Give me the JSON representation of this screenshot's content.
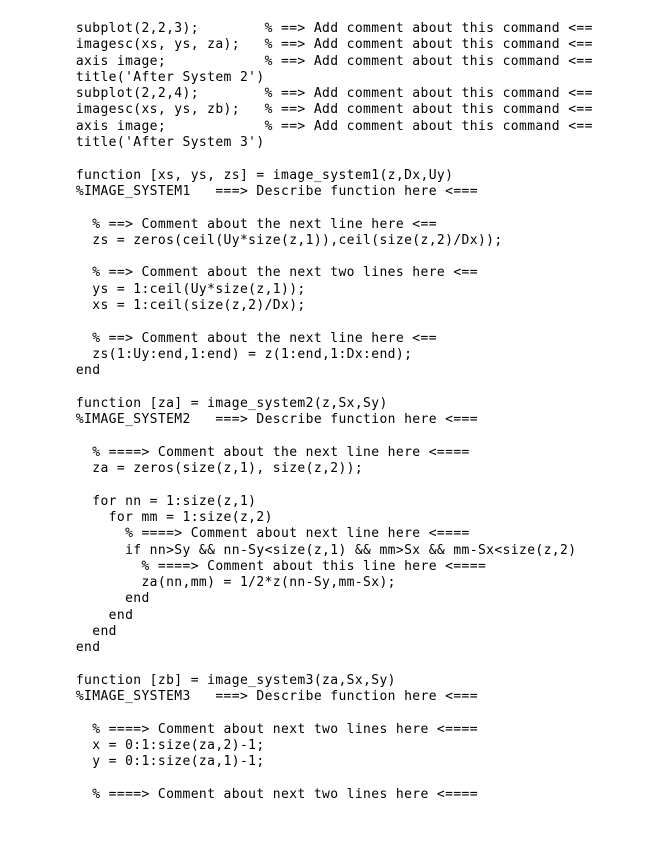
{
  "document": {
    "kind": "matlab-code-listing",
    "language": "MATLAB",
    "background_color": "#ffffff",
    "text_color": "#000000"
  },
  "code": {
    "lines": [
      "    subplot(2,2,3);        % ==> Add comment about this command <==",
      "    imagesc(xs, ys, za);   % ==> Add comment about this command <==",
      "    axis image;            % ==> Add comment about this command <==",
      "    title('After System 2')",
      "    subplot(2,2,4);        % ==> Add comment about this command <==",
      "    imagesc(xs, ys, zb);   % ==> Add comment about this command <==",
      "    axis image;            % ==> Add comment about this command <==",
      "    title('After System 3')",
      "",
      "    function [xs, ys, zs] = image_system1(z,Dx,Uy)",
      "    %IMAGE_SYSTEM1   ===> Describe function here <===",
      "",
      "      % ==> Comment about the next line here <==",
      "      zs = zeros(ceil(Uy*size(z,1)),ceil(size(z,2)/Dx));",
      "",
      "      % ==> Comment about the next two lines here <==",
      "      ys = 1:ceil(Uy*size(z,1));",
      "      xs = 1:ceil(size(z,2)/Dx);",
      "",
      "      % ==> Comment about the next line here <==",
      "      zs(1:Uy:end,1:end) = z(1:end,1:Dx:end);",
      "    end",
      "",
      "    function [za] = image_system2(z,Sx,Sy)",
      "    %IMAGE_SYSTEM2   ===> Describe function here <===",
      "",
      "      % ====> Comment about the next line here <====",
      "      za = zeros(size(z,1), size(z,2));",
      "",
      "      for nn = 1:size(z,1)",
      "        for mm = 1:size(z,2)",
      "          % ====> Comment about next line here <====",
      "          if nn>Sy && nn-Sy<size(z,1) && mm>Sx && mm-Sx<size(z,2)",
      "            % ====> Comment about this line here <====",
      "            za(nn,mm) = 1/2*z(nn-Sy,mm-Sx);",
      "          end",
      "        end",
      "      end",
      "    end",
      "",
      "    function [zb] = image_system3(za,Sx,Sy)",
      "    %IMAGE_SYSTEM3   ===> Describe function here <===",
      "",
      "      % ====> Comment about next two lines here <====",
      "      x = 0:1:size(za,2)-1;",
      "      y = 0:1:size(za,1)-1;",
      "",
      "      % ====> Comment about next two lines here <===="
    ]
  }
}
